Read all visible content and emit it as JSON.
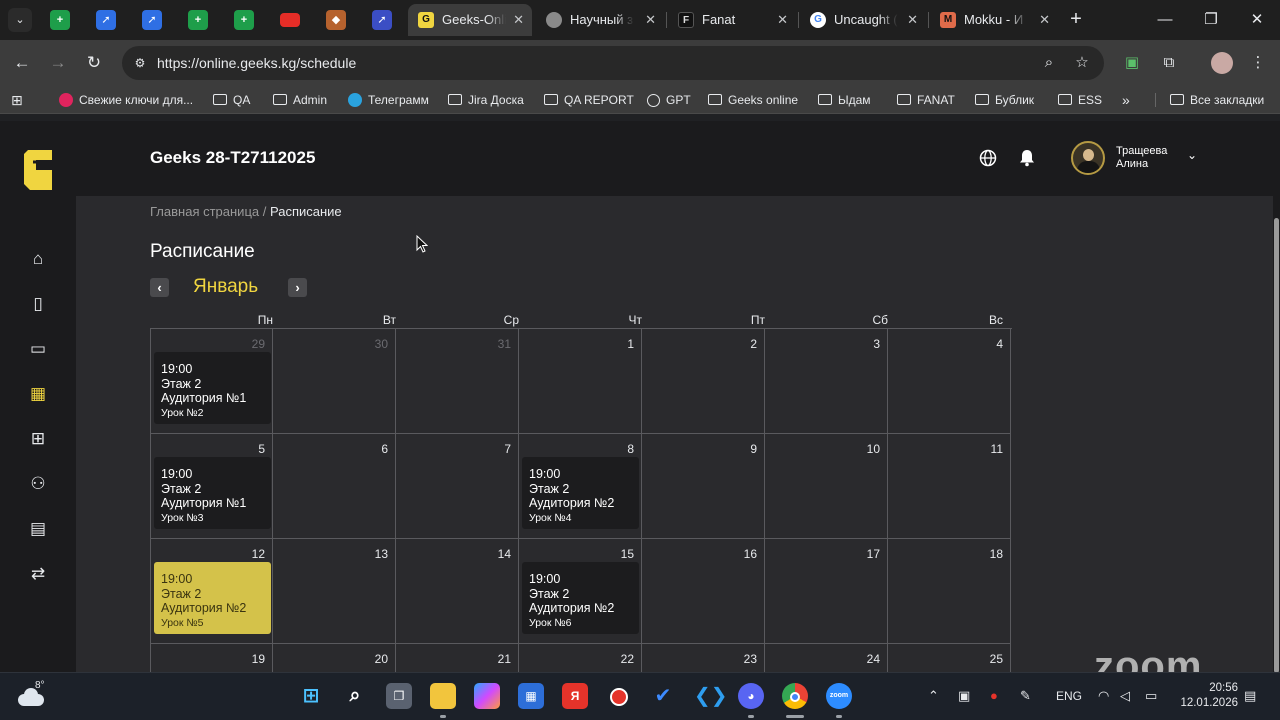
{
  "browser": {
    "tabs": [
      {
        "title": "Geeks-Online",
        "active": true
      },
      {
        "title": "Научный за",
        "active": false
      },
      {
        "title": "Fanat",
        "active": false
      },
      {
        "title": "Uncaught (",
        "active": false
      },
      {
        "title": "Mokku - И",
        "active": false
      }
    ],
    "url": "https://online.geeks.kg/schedule",
    "bookmarks": [
      {
        "label": "Свежие ключи для..."
      },
      {
        "label": "QA"
      },
      {
        "label": "Admin"
      },
      {
        "label": "Телеграмм"
      },
      {
        "label": "Jira Доска"
      },
      {
        "label": "QA REPORT"
      },
      {
        "label": "GPT"
      },
      {
        "label": "Geeks online"
      },
      {
        "label": "Ыдам"
      },
      {
        "label": "FANAT"
      },
      {
        "label": "Бублик"
      },
      {
        "label": "ESS"
      }
    ],
    "all_bookmarks": "Все закладки",
    "colors": {
      "tab_bar": "#1f1f1f",
      "toolbar": "#3c3c3c"
    }
  },
  "app": {
    "group_title": "Geeks 28-T27112025",
    "user": {
      "first_line": "Тращеева",
      "second_line": "Алина"
    },
    "breadcrumb": {
      "home": "Главная страница",
      "separator": " / ",
      "current": "Расписание"
    },
    "page_title": "Расписание",
    "month": "Январь",
    "weekdays": [
      "Пн",
      "Вт",
      "Ср",
      "Чт",
      "Пт",
      "Сб",
      "Вс"
    ],
    "calendar": {
      "weeks": [
        [
          {
            "day": "29",
            "other": true,
            "lesson": {
              "time": "19:00",
              "floor": "Этаж 2",
              "room": "Аудитория №1",
              "lesson": "Урок №2"
            }
          },
          {
            "day": "30",
            "other": true
          },
          {
            "day": "31",
            "other": true
          },
          {
            "day": "1"
          },
          {
            "day": "2"
          },
          {
            "day": "3"
          },
          {
            "day": "4"
          }
        ],
        [
          {
            "day": "5",
            "lesson": {
              "time": "19:00",
              "floor": "Этаж 2",
              "room": "Аудитория №1",
              "lesson": "Урок №3"
            }
          },
          {
            "day": "6"
          },
          {
            "day": "7"
          },
          {
            "day": "8",
            "lesson": {
              "time": "19:00",
              "floor": "Этаж 2",
              "room": "Аудитория №2",
              "lesson": "Урок №4"
            }
          },
          {
            "day": "9"
          },
          {
            "day": "10"
          },
          {
            "day": "11"
          }
        ],
        [
          {
            "day": "12",
            "lesson": {
              "time": "19:00",
              "floor": "Этаж 2",
              "room": "Аудитория №2",
              "lesson": "Урок №5",
              "highlight": true
            }
          },
          {
            "day": "13"
          },
          {
            "day": "14"
          },
          {
            "day": "15",
            "lesson": {
              "time": "19:00",
              "floor": "Этаж 2",
              "room": "Аудитория №2",
              "lesson": "Урок №6"
            }
          },
          {
            "day": "16"
          },
          {
            "day": "17"
          },
          {
            "day": "18"
          }
        ],
        [
          {
            "day": "19"
          },
          {
            "day": "20"
          },
          {
            "day": "21"
          },
          {
            "day": "22"
          },
          {
            "day": "23"
          },
          {
            "day": "24"
          },
          {
            "day": "25"
          }
        ]
      ]
    },
    "colors": {
      "accent": "#f0d540",
      "highlight_lesson": "#d4c24a",
      "page_bg": "#2a2a2d",
      "sidebar_bg": "#1b1b1d"
    }
  },
  "watermark": "zoom",
  "taskbar": {
    "weather_temp": "8°",
    "language": "ENG",
    "time": "20:56",
    "date": "12.01.2026"
  }
}
